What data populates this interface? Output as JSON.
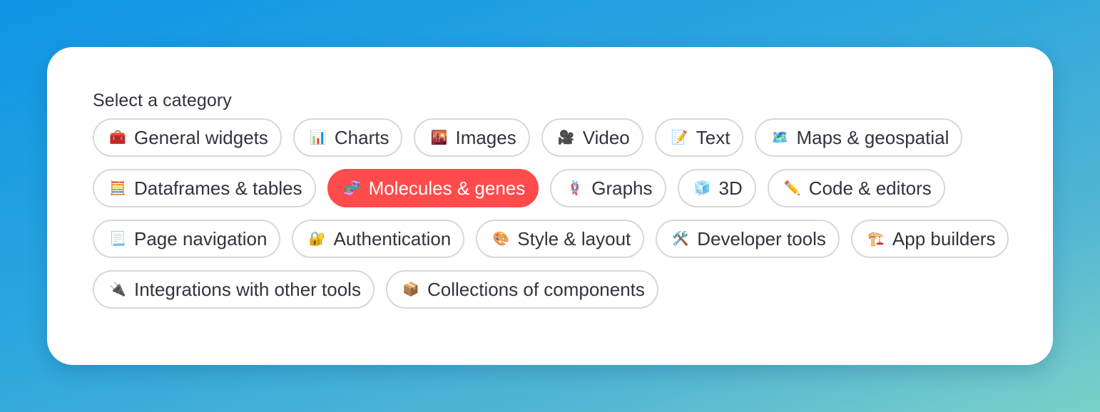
{
  "heading": "Select a category",
  "accent_color": "#ff4b4b",
  "categories": [
    {
      "emoji": "🧰",
      "icon": "toolbox-icon",
      "label": "General widgets",
      "selected": false
    },
    {
      "emoji": "📊",
      "icon": "bar-chart-icon",
      "label": "Charts",
      "selected": false
    },
    {
      "emoji": "🌇",
      "icon": "sunset-image-icon",
      "label": "Images",
      "selected": false
    },
    {
      "emoji": "🎥",
      "icon": "video-camera-icon",
      "label": "Video",
      "selected": false
    },
    {
      "emoji": "📝",
      "icon": "memo-icon",
      "label": "Text",
      "selected": false
    },
    {
      "emoji": "🗺️",
      "icon": "map-icon",
      "label": "Maps & geospatial",
      "selected": false
    },
    {
      "emoji": "🧮",
      "icon": "abacus-icon",
      "label": "Dataframes & tables",
      "selected": false
    },
    {
      "emoji": "🧬",
      "icon": "dna-icon",
      "label": "Molecules & genes",
      "selected": true
    },
    {
      "emoji": "🪢",
      "icon": "knot-icon",
      "label": "Graphs",
      "selected": false
    },
    {
      "emoji": "🧊",
      "icon": "ice-cube-icon",
      "label": "3D",
      "selected": false
    },
    {
      "emoji": "✏️",
      "icon": "pencil-icon",
      "label": "Code & editors",
      "selected": false
    },
    {
      "emoji": "📃",
      "icon": "page-icon",
      "label": "Page navigation",
      "selected": false
    },
    {
      "emoji": "🔐",
      "icon": "lock-key-icon",
      "label": "Authentication",
      "selected": false
    },
    {
      "emoji": "🎨",
      "icon": "palette-icon",
      "label": "Style & layout",
      "selected": false
    },
    {
      "emoji": "🛠️",
      "icon": "tools-icon",
      "label": "Developer tools",
      "selected": false
    },
    {
      "emoji": "🏗️",
      "icon": "construction-crane-icon",
      "label": "App builders",
      "selected": false
    },
    {
      "emoji": "🔌",
      "icon": "plug-icon",
      "label": "Integrations with other tools",
      "selected": false
    },
    {
      "emoji": "📦",
      "icon": "package-icon",
      "label": "Collections of components",
      "selected": false
    }
  ]
}
